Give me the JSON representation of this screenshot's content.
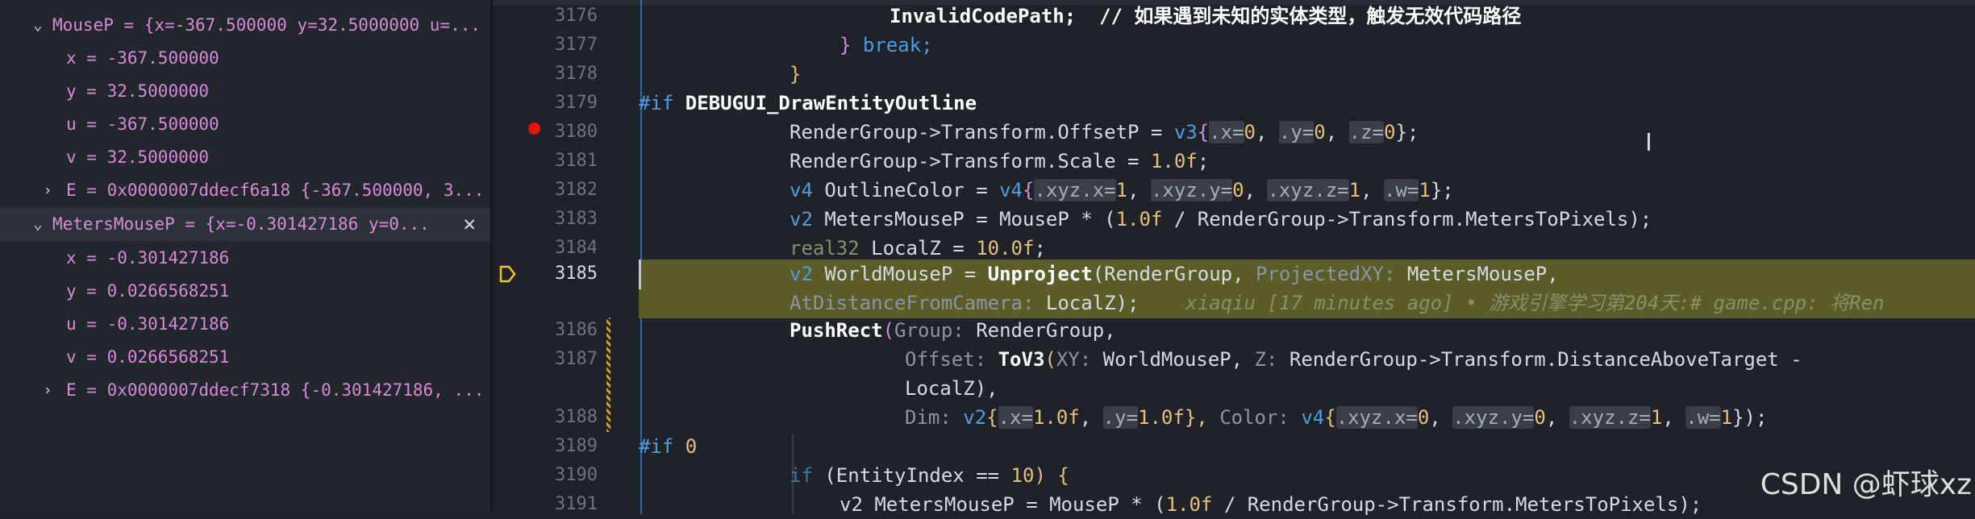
{
  "variables": {
    "mouse_p": {
      "name": "MouseP",
      "summary": "{x=-367.500000 y=32.5000000 u=...",
      "fields": [
        {
          "name": "x",
          "value": "-367.500000"
        },
        {
          "name": "y",
          "value": "32.5000000"
        },
        {
          "name": "u",
          "value": "-367.500000"
        },
        {
          "name": "v",
          "value": "32.5000000"
        }
      ],
      "e_row": {
        "name": "E",
        "value": "0x0000007ddecf6a18 {-367.500000, 3..."
      }
    },
    "meters_mouse_p": {
      "name": "MetersMouseP",
      "summary": "{x=-0.301427186 y=0...",
      "fields": [
        {
          "name": "x",
          "value": "-0.301427186"
        },
        {
          "name": "y",
          "value": "0.0266568251"
        },
        {
          "name": "u",
          "value": "-0.301427186"
        },
        {
          "name": "v",
          "value": "0.0266568251"
        }
      ],
      "e_row": {
        "name": "E",
        "value": "0x0000007ddecf7318 {-0.301427186, ..."
      }
    },
    "icons": {
      "expanded": "chevron-down-icon",
      "collapsed": "chevron-right-icon",
      "close": "close-icon"
    }
  },
  "editor": {
    "line_numbers": [
      "3176",
      "3177",
      "3178",
      "3179",
      "3180",
      "3181",
      "3182",
      "3183",
      "3184",
      "3185",
      "3186",
      "3187",
      "3188",
      "3189",
      "3190",
      "3191"
    ],
    "current_line": "3185",
    "code": {
      "l3176": "InvalidCodePath;  // 如果遇到未知的实体类型，触发无效代码路径",
      "l3177_close": "}",
      "l3177_break": " break;",
      "l3178": "}",
      "l3179_pp": "#if",
      "l3179_name": " DEBUGUI_DrawEntityOutline",
      "l3180_a": "RenderGroup->Transform.OffsetP = ",
      "l3180_b": "v3",
      "l3180_c": "{",
      "l3180_d": ".x=",
      "l3180_e": "0",
      "l3180_f": ", ",
      "l3180_g": ".y=",
      "l3180_h": "0",
      "l3180_i": ", ",
      "l3180_j": ".z=",
      "l3180_k": "0",
      "l3180_l": "};",
      "l3181_a": "RenderGroup->Transform.Scale = ",
      "l3181_b": "1.0f",
      "l3181_c": ";",
      "l3182_a": "v4",
      "l3182_b": " OutlineColor = ",
      "l3182_c": "v4",
      "l3182_d": "{",
      "l3182_e": ".xyz.x=",
      "l3182_f": "1",
      "l3182_g": ", ",
      "l3182_h": ".xyz.y=",
      "l3182_i": "0",
      "l3182_j": ", ",
      "l3182_k": ".xyz.z=",
      "l3182_l": "1",
      "l3182_m": ", ",
      "l3182_n": ".w=",
      "l3182_o": "1",
      "l3182_p": "};",
      "l3183_a": "v2",
      "l3183_b": " MetersMouseP = MouseP * (",
      "l3183_c": "1.0f",
      "l3183_d": " / RenderGroup->Transform.MetersToPixels);",
      "l3184_a": "real32",
      "l3184_b": " LocalZ = ",
      "l3184_c": "10.0f",
      "l3184_d": ";",
      "l3185_a": "v2",
      "l3185_b": " WorldMouseP = ",
      "l3185_c": "Unproject",
      "l3185_d": "(RenderGroup, ",
      "l3185_e": "ProjectedXY:",
      "l3185_f": " MetersMouseP,",
      "l3185w_a": "AtDistanceFromCamera:",
      "l3185w_b": " LocalZ);",
      "blame": "    xiaqiu [17 minutes ago] • 游戏引擎学习第204天:# game.cpp: 将Ren",
      "l3186_a": "PushRect",
      "l3186_b": "(",
      "l3186_c": "Group:",
      "l3186_d": " RenderGroup,",
      "l3187_a": "Offset:",
      "l3187_b": " ",
      "l3187_c": "ToV3",
      "l3187_d": "(",
      "l3187_e": "XY:",
      "l3187_f": " WorldMouseP, ",
      "l3187_g": "Z:",
      "l3187_h": " RenderGroup->Transform.DistanceAboveTarget -",
      "l3187w": "LocalZ),",
      "l3188_a": "Dim:",
      "l3188_b": " ",
      "l3188_c": "v2",
      "l3188_d": "{",
      "l3188_e": ".x=",
      "l3188_f": "1.0f",
      "l3188_g": ", ",
      "l3188_h": ".y=",
      "l3188_i": "1.0f",
      "l3188_j": "}, ",
      "l3188_k": "Color:",
      "l3188_l": " ",
      "l3188_m": "v4",
      "l3188_n": "{",
      "l3188_o": ".xyz.x=",
      "l3188_p": "0",
      "l3188_q": ", ",
      "l3188_r": ".xyz.y=",
      "l3188_s": "0",
      "l3188_t": ", ",
      "l3188_u": ".xyz.z=",
      "l3188_v": "1",
      "l3188_w": ", ",
      "l3188_x": ".w=",
      "l3188_y": "1",
      "l3188_z": "});",
      "l3189_a": "#if",
      "l3189_b": " 0",
      "l3190_a": "if",
      "l3190_b": " (EntityIndex == ",
      "l3190_c": "10",
      "l3190_d": ") {",
      "l3191_a": "v2 MetersMouseP = MouseP * (",
      "l3191_b": "1.0f",
      "l3191_c": " / RenderGroup->Transform.MetersToPixels);"
    }
  },
  "watermark": "CSDN @虾球xz"
}
